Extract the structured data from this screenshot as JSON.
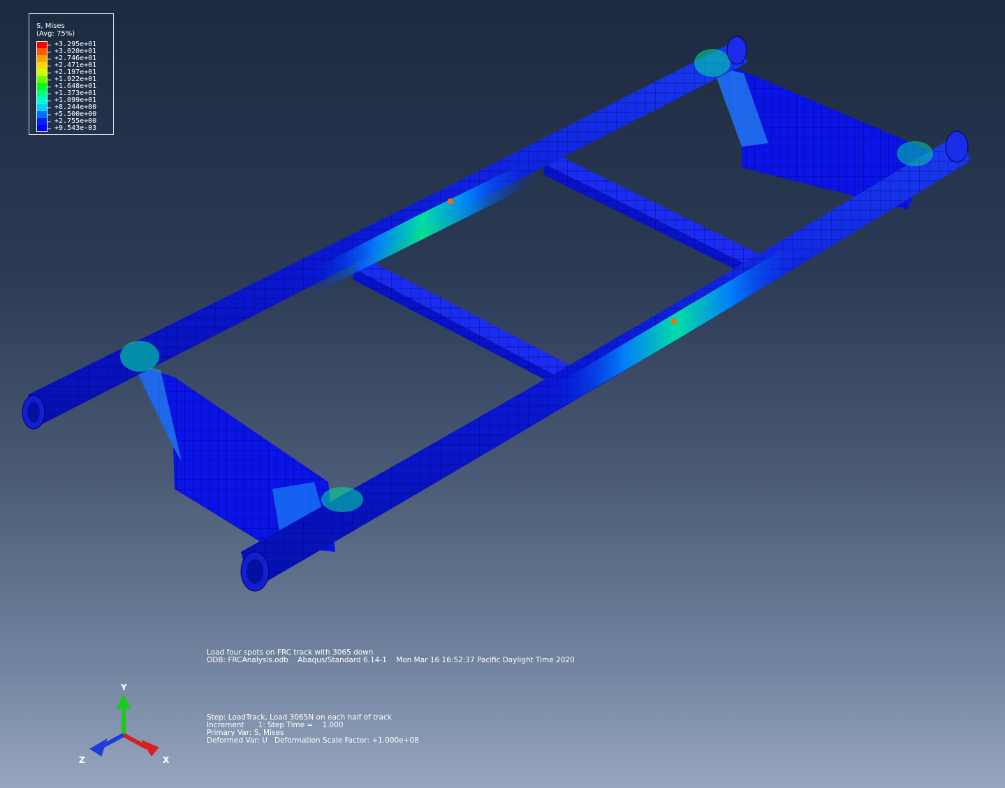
{
  "legend": {
    "title": "S, Mises",
    "subtitle": "(Avg: 75%)",
    "entries": [
      {
        "value": "+3.295e+01",
        "color": "#ff0000"
      },
      {
        "value": "+3.020e+01",
        "color": "#ff5a00"
      },
      {
        "value": "+2.746e+01",
        "color": "#ffa200"
      },
      {
        "value": "+2.471e+01",
        "color": "#ffd800"
      },
      {
        "value": "+2.197e+01",
        "color": "#cdff00"
      },
      {
        "value": "+1.922e+01",
        "color": "#6cff00"
      },
      {
        "value": "+1.648e+01",
        "color": "#00ff1a"
      },
      {
        "value": "+1.373e+01",
        "color": "#00ff7e"
      },
      {
        "value": "+1.099e+01",
        "color": "#00ffd5"
      },
      {
        "value": "+8.244e+00",
        "color": "#00d0ff"
      },
      {
        "value": "+5.500e+00",
        "color": "#0072ff"
      },
      {
        "value": "+2.755e+00",
        "color": "#0022ff"
      },
      {
        "value": "+9.543e-03",
        "color": "#0000ff"
      }
    ]
  },
  "info": {
    "title_line": "Load four spots on FRC track with 3065 down",
    "odb_line": "ODB: FRCAnalysis.odb    Abaqus/Standard 6.14-1    Mon Mar 16 16:52:37 Pacific Daylight Time 2020",
    "step_line": "Step: LoadTrack, Load 3065N on each half of track",
    "increment_line": "Increment      1: Step Time =    1.000",
    "primary_var_line": "Primary Var: S, Mises",
    "deformed_var_line": "Deformed Var: U   Deformation Scale Factor: +1.000e+08"
  },
  "triad": {
    "x_label": "X",
    "y_label": "Y",
    "z_label": "Z",
    "x_color": "#d81e1e",
    "y_color": "#1ec81e",
    "z_color": "#1e3cd8"
  },
  "model": {
    "mesh_color": "#0a0aa0",
    "base_color": "#0a14e6"
  }
}
